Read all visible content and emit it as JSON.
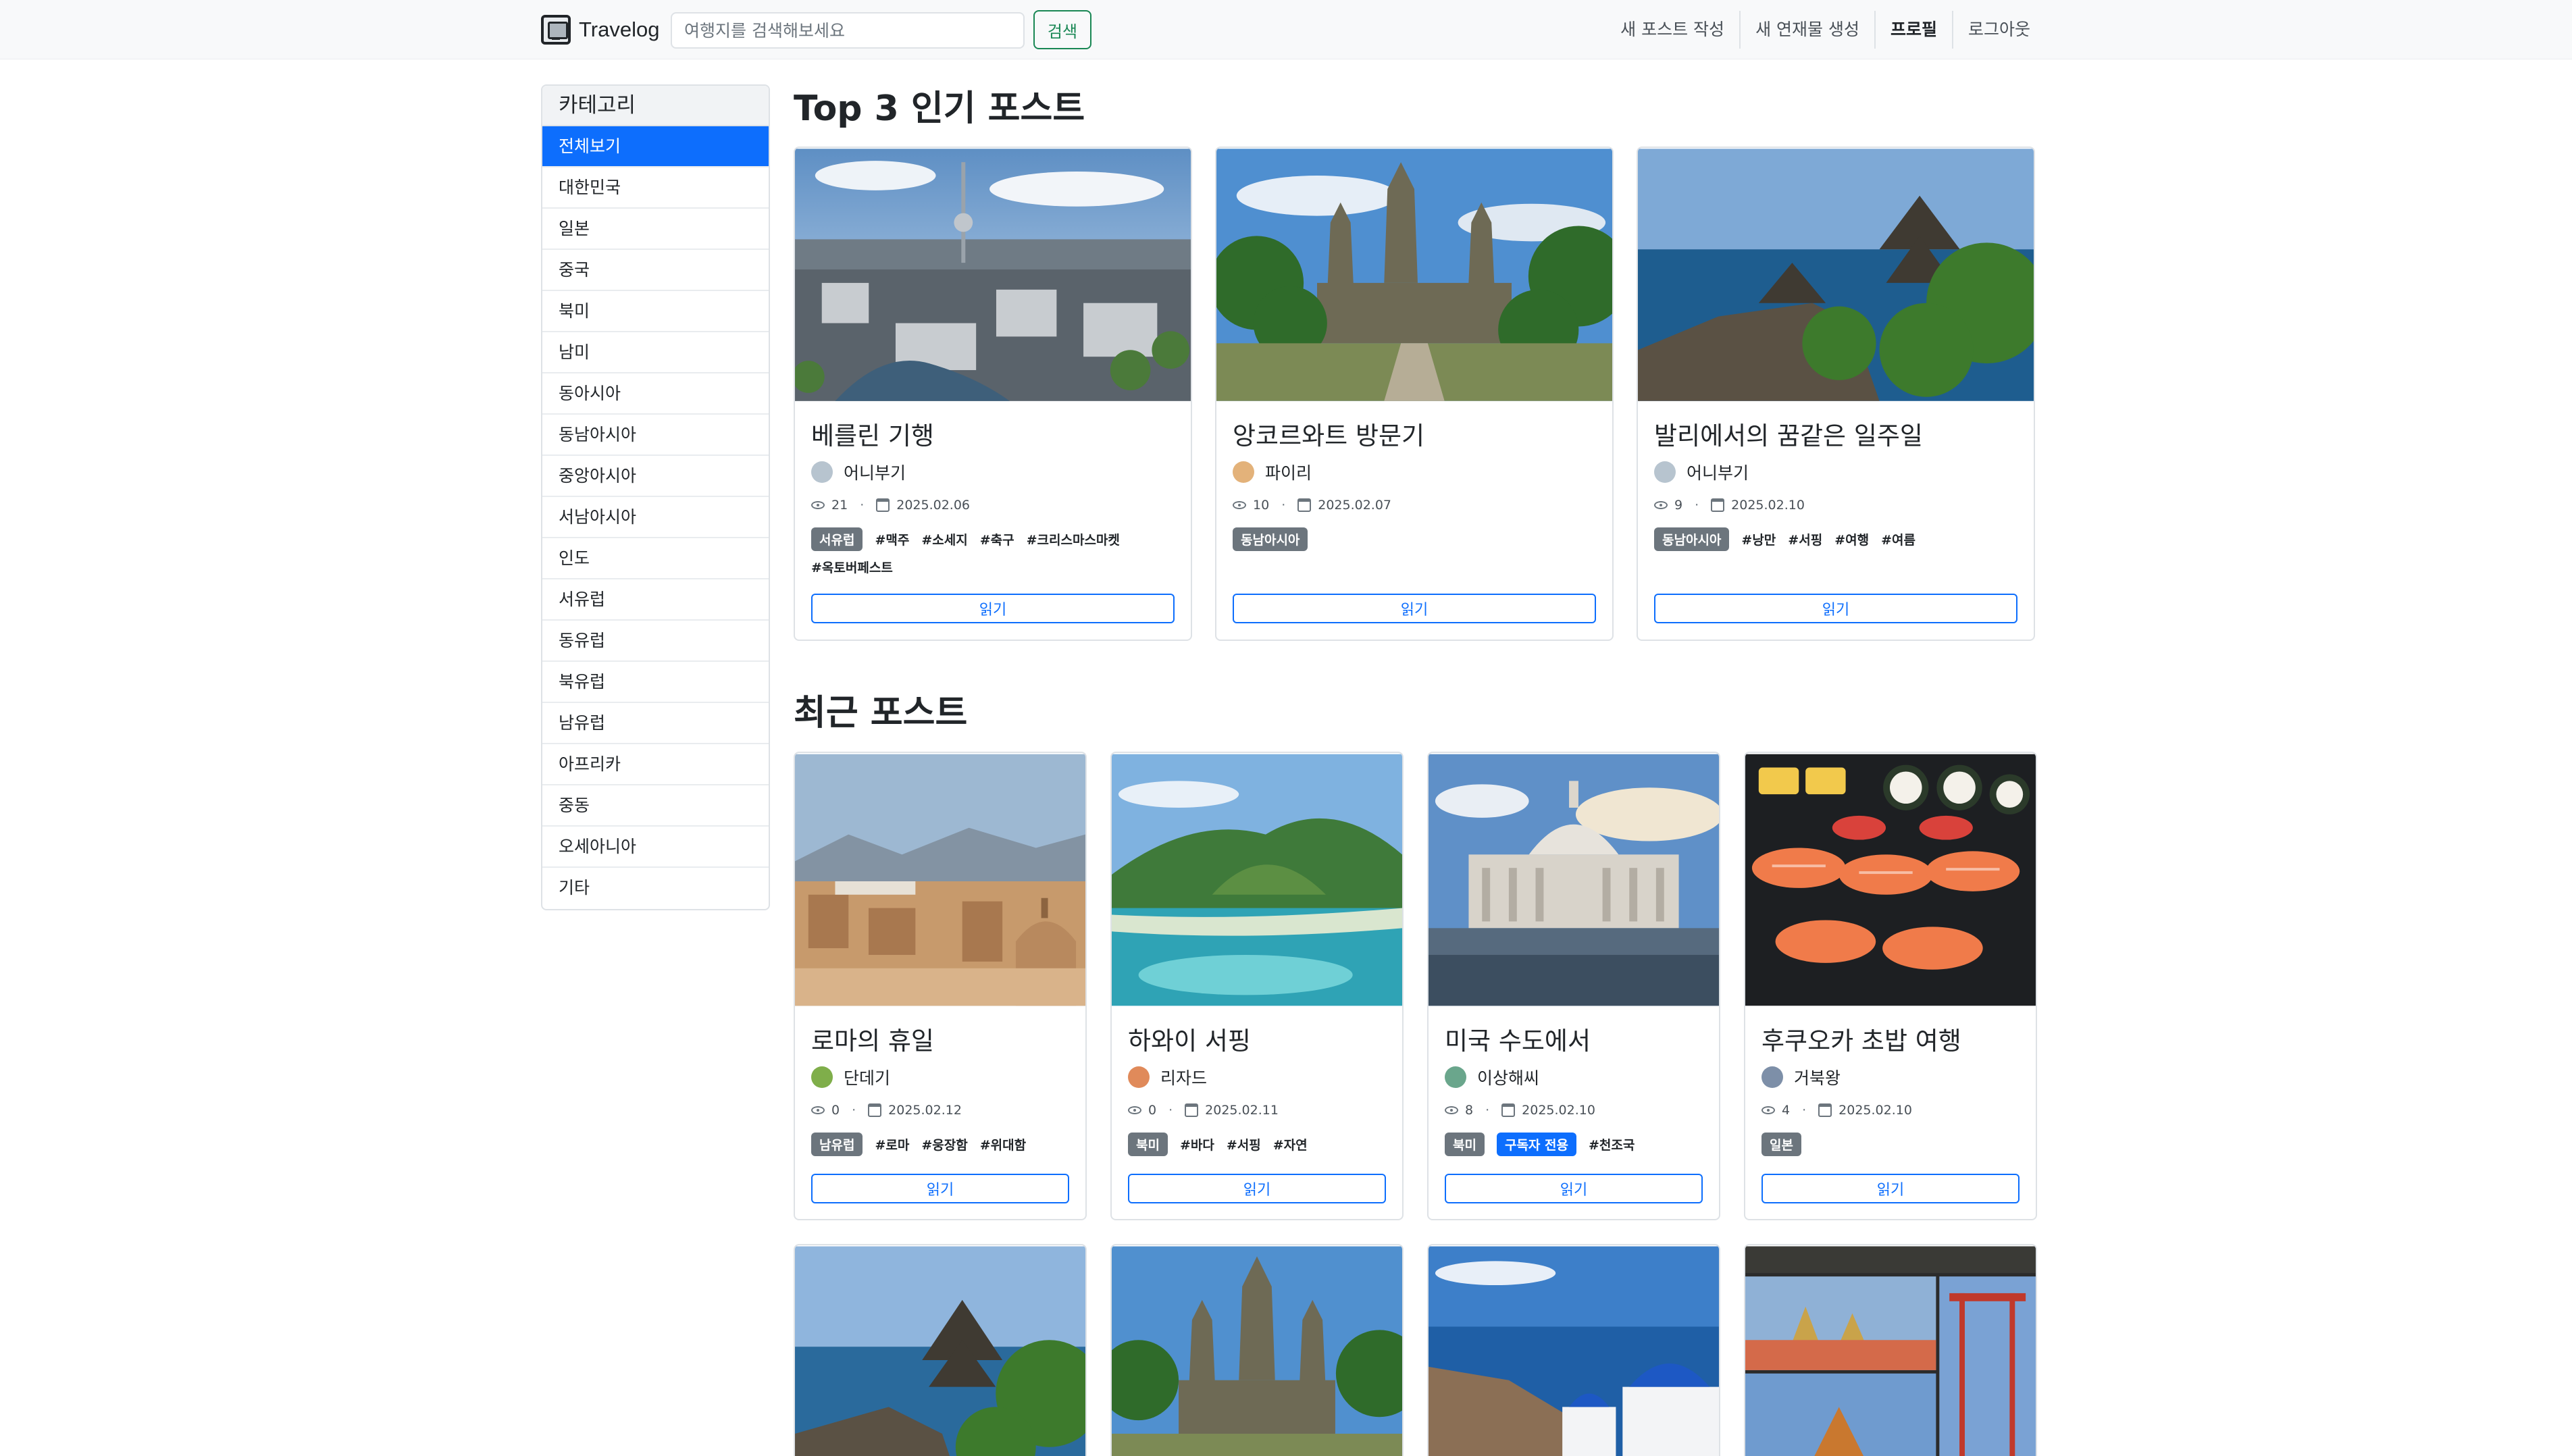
{
  "nav": {
    "brand": "Travelog",
    "search_placeholder": "여행지를 검색해보세요",
    "search_button": "검색",
    "links": [
      "새 포스트 작성",
      "새 연재물 생성",
      "프로필",
      "로그아웃"
    ]
  },
  "sidebar": {
    "title": "카테고리",
    "items": [
      "전체보기",
      "대한민국",
      "일본",
      "중국",
      "북미",
      "남미",
      "동아시아",
      "동남아시아",
      "중앙아시아",
      "서남아시아",
      "인도",
      "서유럽",
      "동유럽",
      "북유럽",
      "남유럽",
      "아프리카",
      "중동",
      "오세아니아",
      "기타"
    ],
    "active_index": 0
  },
  "top_section": {
    "title": "Top 3 인기 포스트",
    "posts": [
      {
        "title": "베를린 기행",
        "author": "어니부기",
        "views": "21",
        "date": "2025.02.06",
        "badges": [
          "서유럽"
        ],
        "tags": [
          "#맥주",
          "#소세지",
          "#축구",
          "#크리스마스마켓",
          "#옥토버페스트"
        ],
        "read": "읽기",
        "image": "berlin-city-aerial"
      },
      {
        "title": "앙코르와트 방문기",
        "author": "파이리",
        "views": "10",
        "date": "2025.02.07",
        "badges": [
          "동남아시아"
        ],
        "tags": [],
        "read": "읽기",
        "image": "angkor-wat-temple"
      },
      {
        "title": "발리에서의 꿈같은 일주일",
        "author": "어니부기",
        "views": "9",
        "date": "2025.02.10",
        "badges": [
          "동남아시아"
        ],
        "tags": [
          "#낭만",
          "#서핑",
          "#여행",
          "#여름"
        ],
        "read": "읽기",
        "image": "bali-sea-temple"
      }
    ]
  },
  "recent_section": {
    "title": "최근 포스트",
    "posts": [
      {
        "title": "로마의 휴일",
        "author": "단데기",
        "views": "0",
        "date": "2025.02.12",
        "badges": [
          "남유럽"
        ],
        "tags": [
          "#로마",
          "#웅장함",
          "#위대함"
        ],
        "read": "읽기",
        "image": "rome-cityscape"
      },
      {
        "title": "하와이 서핑",
        "author": "리자드",
        "views": "0",
        "date": "2025.02.11",
        "badges": [
          "북미"
        ],
        "tags": [
          "#바다",
          "#서핑",
          "#자연"
        ],
        "read": "읽기",
        "image": "hawaii-diamond-head"
      },
      {
        "title": "미국 수도에서",
        "author": "이상해씨",
        "views": "8",
        "date": "2025.02.10",
        "badges": [
          "북미",
          "구독자 전용"
        ],
        "tags": [
          "#천조국"
        ],
        "read": "읽기",
        "image": "us-capitol"
      },
      {
        "title": "후쿠오카 초밥 여행",
        "author": "거북왕",
        "views": "4",
        "date": "2025.02.10",
        "badges": [
          "일본"
        ],
        "tags": [],
        "read": "읽기",
        "image": "sushi-platter"
      }
    ],
    "more_images": [
      "bali-sea-temple",
      "angkor-wat-temple",
      "santorini-domes",
      "bangkok-collage"
    ]
  },
  "colors": {
    "primary": "#0d6efd",
    "success": "#198754",
    "badge_gray": "#6c757d",
    "navbar_bg": "#f8f9fa"
  }
}
